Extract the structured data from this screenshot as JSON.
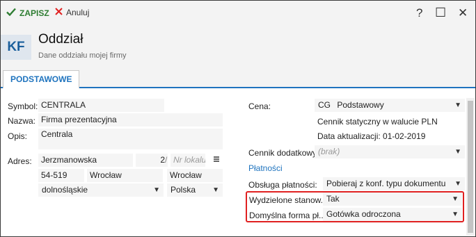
{
  "toolbar": {
    "save_label": "ZAPISZ",
    "save_icon": "check-icon",
    "cancel_label": "Anuluj",
    "cancel_icon": "close-icon",
    "help_glyph": "?",
    "maximize_glyph": "☐",
    "close_glyph": "✕"
  },
  "header": {
    "avatar_text": "KF",
    "title": "Oddział",
    "subtitle": "Dane oddziału mojej firmy"
  },
  "tabs": [
    {
      "label": "PODSTAWOWE",
      "active": true
    }
  ],
  "form": {
    "symbol": {
      "label": "Symbol:",
      "value": "CENTRALA"
    },
    "nazwa": {
      "label": "Nazwa:",
      "value": "Firma prezentacyjna"
    },
    "opis": {
      "label": "Opis:",
      "value": "Centrala"
    },
    "adres": {
      "label": "Adres:",
      "street": "Jerzmanowska",
      "building_number": "2",
      "separator": "/",
      "unit_placeholder": "Nr lokalu",
      "postal_code": "54-519",
      "city": "Wrocław",
      "post_office": "Wrocław",
      "voivodeship": "dolnośląskie",
      "country": "Polska"
    }
  },
  "right": {
    "cena": {
      "label": "Cena:",
      "code": "CG",
      "value": "Podstawowy"
    },
    "cennik_info": "Cennik statyczny w walucie PLN",
    "data_aktualizacji": "Data aktualizacji: 01-02-2019",
    "cennik_dodatkowy": {
      "label": "Cennik dodatkowy:",
      "placeholder": "(brak)"
    },
    "platnosci_link": "Płatności",
    "obsluga_platnosci": {
      "label": "Obsługa płatności:",
      "value": "Pobieraj z konf. typu dokumentu"
    },
    "wydzielone": {
      "label": "Wydzielone stanow...",
      "value": "Tak"
    },
    "domyslna_forma": {
      "label": "Domyślna forma pł...",
      "value": "Gotówka odroczona"
    }
  },
  "colors": {
    "accent": "#1e73be",
    "save_green": "#2e7d32",
    "cancel_red": "#e02020",
    "highlight_red": "#e02020"
  }
}
